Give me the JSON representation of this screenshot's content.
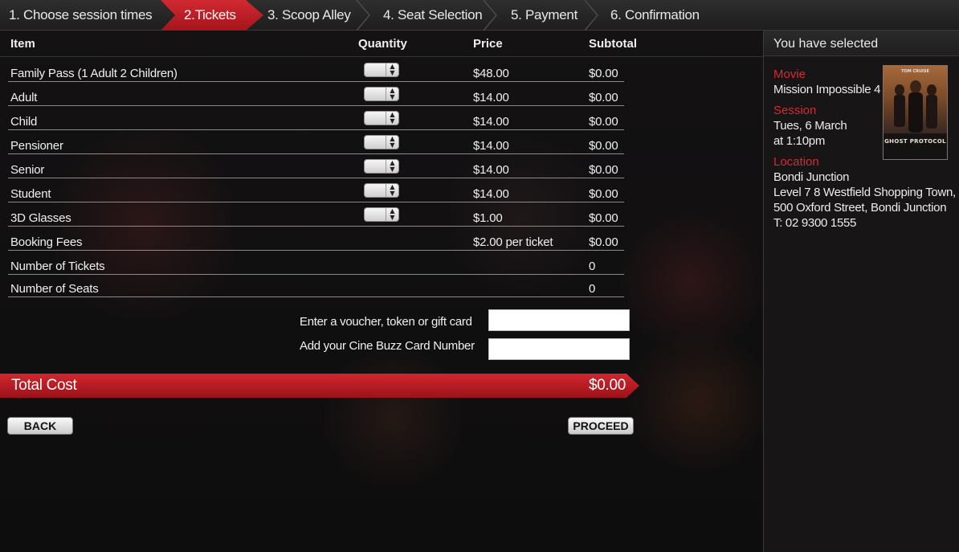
{
  "steps": [
    {
      "label": "1. Choose session times"
    },
    {
      "label": "2.Tickets"
    },
    {
      "label": "3. Scoop Alley"
    },
    {
      "label": "4. Seat Selection"
    },
    {
      "label": "5. Payment"
    },
    {
      "label": "6. Confirmation"
    }
  ],
  "table": {
    "headers": {
      "item": "Item",
      "quantity": "Quantity",
      "price": "Price",
      "subtotal": "Subtotal"
    },
    "rows": [
      {
        "item": "Family Pass (1 Adult  2 Children)",
        "price": "$48.00",
        "subtotal": "$0.00"
      },
      {
        "item": "Adult",
        "price": "$14.00",
        "subtotal": "$0.00"
      },
      {
        "item": "Child",
        "price": "$14.00",
        "subtotal": "$0.00"
      },
      {
        "item": "Pensioner",
        "price": "$14.00",
        "subtotal": "$0.00"
      },
      {
        "item": "Senior",
        "price": "$14.00",
        "subtotal": "$0.00"
      },
      {
        "item": "Student",
        "price": "$14.00",
        "subtotal": "$0.00"
      },
      {
        "item": "3D Glasses",
        "price": "$1.00",
        "subtotal": "$0.00"
      },
      {
        "item": "Booking Fees",
        "price": "$2.00 per ticket",
        "subtotal": "$0.00"
      },
      {
        "item": "Number of Tickets",
        "price": "",
        "subtotal": "0"
      },
      {
        "item": "Number of Seats",
        "price": "",
        "subtotal": "0"
      }
    ]
  },
  "voucher": {
    "label": "Enter a voucher, token or gift card",
    "value": ""
  },
  "buzz_card": {
    "label": "Add your Cine Buzz Card Number",
    "value": ""
  },
  "total": {
    "label": "Total Cost",
    "value": "$0.00"
  },
  "buttons": {
    "back": "BACK",
    "proceed": "PROCEED"
  },
  "sidebar": {
    "title": "You have selected",
    "movie_label": "Movie",
    "movie": "Mission Impossible 4",
    "session_label": "Session",
    "session_date": "Tues, 6 March",
    "session_time": "at 1:10pm",
    "location_label": "Location",
    "location_name": "Bondi Junction",
    "address_line1": "Level 7 8 Westfield Shopping Town,",
    "address_line2": "500 Oxford Street, Bondi Junction",
    "phone": "T: 02 9300 1555",
    "poster_title": "GHOST PROTOCOL",
    "poster_top": "TOM CRUISE"
  },
  "colors": {
    "accent": "#c81e27",
    "background": "#0e0d0e",
    "panel": "#1a1819"
  }
}
